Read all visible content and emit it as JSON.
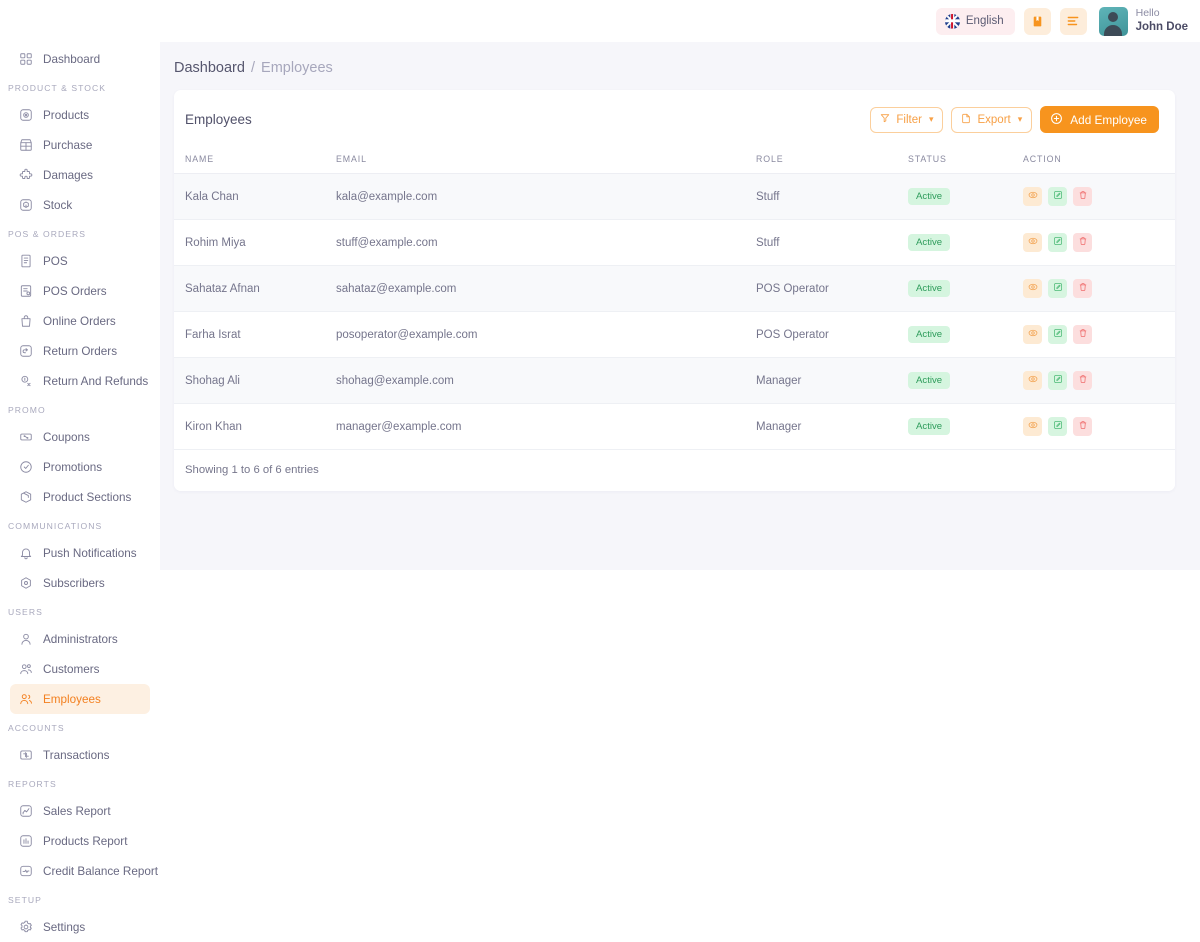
{
  "topbar": {
    "language": {
      "label": "English",
      "icon": "uk-flag-icon"
    },
    "icons": [
      {
        "name": "book-icon"
      },
      {
        "name": "list-icon"
      }
    ],
    "user": {
      "greeting": "Hello",
      "name": "John Doe",
      "avatar": "user-avatar"
    }
  },
  "sidebar": {
    "groups": [
      {
        "section": null,
        "items": [
          {
            "label": "Dashboard",
            "icon": "grid-icon",
            "active": false
          }
        ]
      },
      {
        "section": "PRODUCT & STOCK",
        "items": [
          {
            "label": "Products",
            "icon": "box-circle-icon",
            "active": false
          },
          {
            "label": "Purchase",
            "icon": "store-icon",
            "active": false
          },
          {
            "label": "Damages",
            "icon": "puzzle-icon",
            "active": false
          },
          {
            "label": "Stock",
            "icon": "cube-icon",
            "active": false
          }
        ]
      },
      {
        "section": "POS & ORDERS",
        "items": [
          {
            "label": "POS",
            "icon": "receipt-icon",
            "active": false
          },
          {
            "label": "POS Orders",
            "icon": "invoice-icon",
            "active": false
          },
          {
            "label": "Online Orders",
            "icon": "bag-icon",
            "active": false
          },
          {
            "label": "Return Orders",
            "icon": "return-box-icon",
            "active": false
          },
          {
            "label": "Return And Refunds",
            "icon": "refund-icon",
            "active": false
          }
        ]
      },
      {
        "section": "PROMO",
        "items": [
          {
            "label": "Coupons",
            "icon": "coupon-icon",
            "active": false
          },
          {
            "label": "Promotions",
            "icon": "tag-icon",
            "active": false
          },
          {
            "label": "Product Sections",
            "icon": "package-icon",
            "active": false
          }
        ]
      },
      {
        "section": "COMMUNICATIONS",
        "items": [
          {
            "label": "Push Notifications",
            "icon": "bell-icon",
            "active": false
          },
          {
            "label": "Subscribers",
            "icon": "target-icon",
            "active": false
          }
        ]
      },
      {
        "section": "USERS",
        "items": [
          {
            "label": "Administrators",
            "icon": "user-icon",
            "active": false
          },
          {
            "label": "Customers",
            "icon": "users-icon",
            "active": false
          },
          {
            "label": "Employees",
            "icon": "employees-icon",
            "active": true
          }
        ]
      },
      {
        "section": "ACCOUNTS",
        "items": [
          {
            "label": "Transactions",
            "icon": "transaction-icon",
            "active": false
          }
        ]
      },
      {
        "section": "REPORTS",
        "items": [
          {
            "label": "Sales Report",
            "icon": "chart-up-icon",
            "active": false
          },
          {
            "label": "Products Report",
            "icon": "bar-chart-icon",
            "active": false
          },
          {
            "label": "Credit Balance Report",
            "icon": "pulse-icon",
            "active": false
          }
        ]
      },
      {
        "section": "SETUP",
        "items": [
          {
            "label": "Settings",
            "icon": "gear-icon",
            "active": false
          }
        ]
      }
    ]
  },
  "breadcrumb": {
    "root": "Dashboard",
    "separator": "/",
    "current": "Employees"
  },
  "card": {
    "title": "Employees",
    "filter_label": "Filter",
    "export_label": "Export",
    "add_label": "Add Employee",
    "footer": "Showing 1 to 6 of 6 entries"
  },
  "table": {
    "columns": [
      "NAME",
      "EMAIL",
      "ROLE",
      "STATUS",
      "ACTION"
    ],
    "rows": [
      {
        "name": "Kala Chan",
        "email": "kala@example.com",
        "role": "Stuff",
        "status": "Active"
      },
      {
        "name": "Rohim Miya",
        "email": "stuff@example.com",
        "role": "Stuff",
        "status": "Active"
      },
      {
        "name": "Sahataz Afnan",
        "email": "sahataz@example.com",
        "role": "POS Operator",
        "status": "Active"
      },
      {
        "name": "Farha Israt",
        "email": "posoperator@example.com",
        "role": "POS Operator",
        "status": "Active"
      },
      {
        "name": "Shohag Ali",
        "email": "shohag@example.com",
        "role": "Manager",
        "status": "Active"
      },
      {
        "name": "Kiron Khan",
        "email": "manager@example.com",
        "role": "Manager",
        "status": "Active"
      }
    ],
    "action_icons": [
      "eye-icon",
      "edit-icon",
      "trash-icon"
    ]
  },
  "colors": {
    "accent": "#f7941e",
    "accent_soft": "#fdf0e2",
    "page_bg": "#f6f6fa",
    "status_green": "#2e9c5b",
    "status_green_bg": "#d5f5df"
  }
}
